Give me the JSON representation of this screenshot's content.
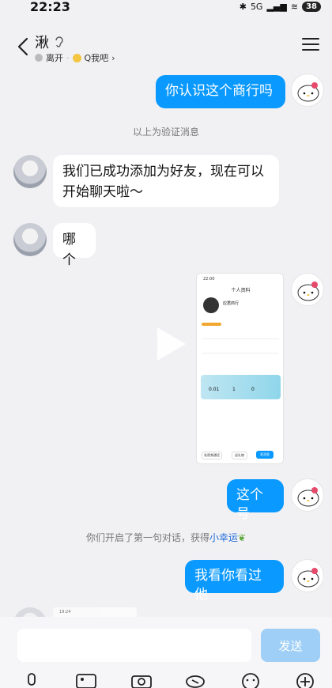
{
  "status": {
    "time": "22:23",
    "network": "5G",
    "battery": "38"
  },
  "header": {
    "name": "湫",
    "status_text": "离开",
    "qzone_label": "Q我吧"
  },
  "messages": {
    "m1": "你认识这个商行吗",
    "sys1": "以上为验证消息",
    "m2": "我们已成功添加为好友，现在可以开始聊天啦～",
    "m3": "哪个",
    "m4": "这个号",
    "sys2_prefix": "你们开启了第一句对话，获得",
    "sys2_highlight": "小幸运",
    "m5": "我看你看过他"
  },
  "shot": {
    "time": "22:00",
    "title": "个人资料",
    "name": "应君商行",
    "stats": [
      "0.01",
      "1",
      "0"
    ],
    "btn1": "发视频通话",
    "btn2": "送礼物",
    "btn3": "发消息"
  },
  "partial_preview": {
    "time": "19:24"
  },
  "input": {
    "send_label": "发送"
  }
}
